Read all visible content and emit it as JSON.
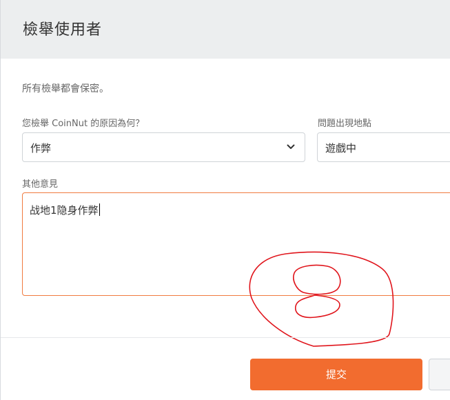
{
  "dialog": {
    "title": "檢舉使用者",
    "notice": "所有檢舉都會保密。"
  },
  "form": {
    "reason": {
      "label": "您檢舉 CoinNut 的原因為何？",
      "value": "作弊",
      "icon": "chevron-down-icon"
    },
    "location": {
      "label": "問題出現地點",
      "value": "遊戲中"
    },
    "comments": {
      "label": "其他意見",
      "value": "战地1隐身作弊"
    }
  },
  "footer": {
    "submit_label": "提交"
  },
  "colors": {
    "accent": "#f26c2f",
    "header_bg": "#eceeef",
    "annotation": "#e0141b"
  }
}
